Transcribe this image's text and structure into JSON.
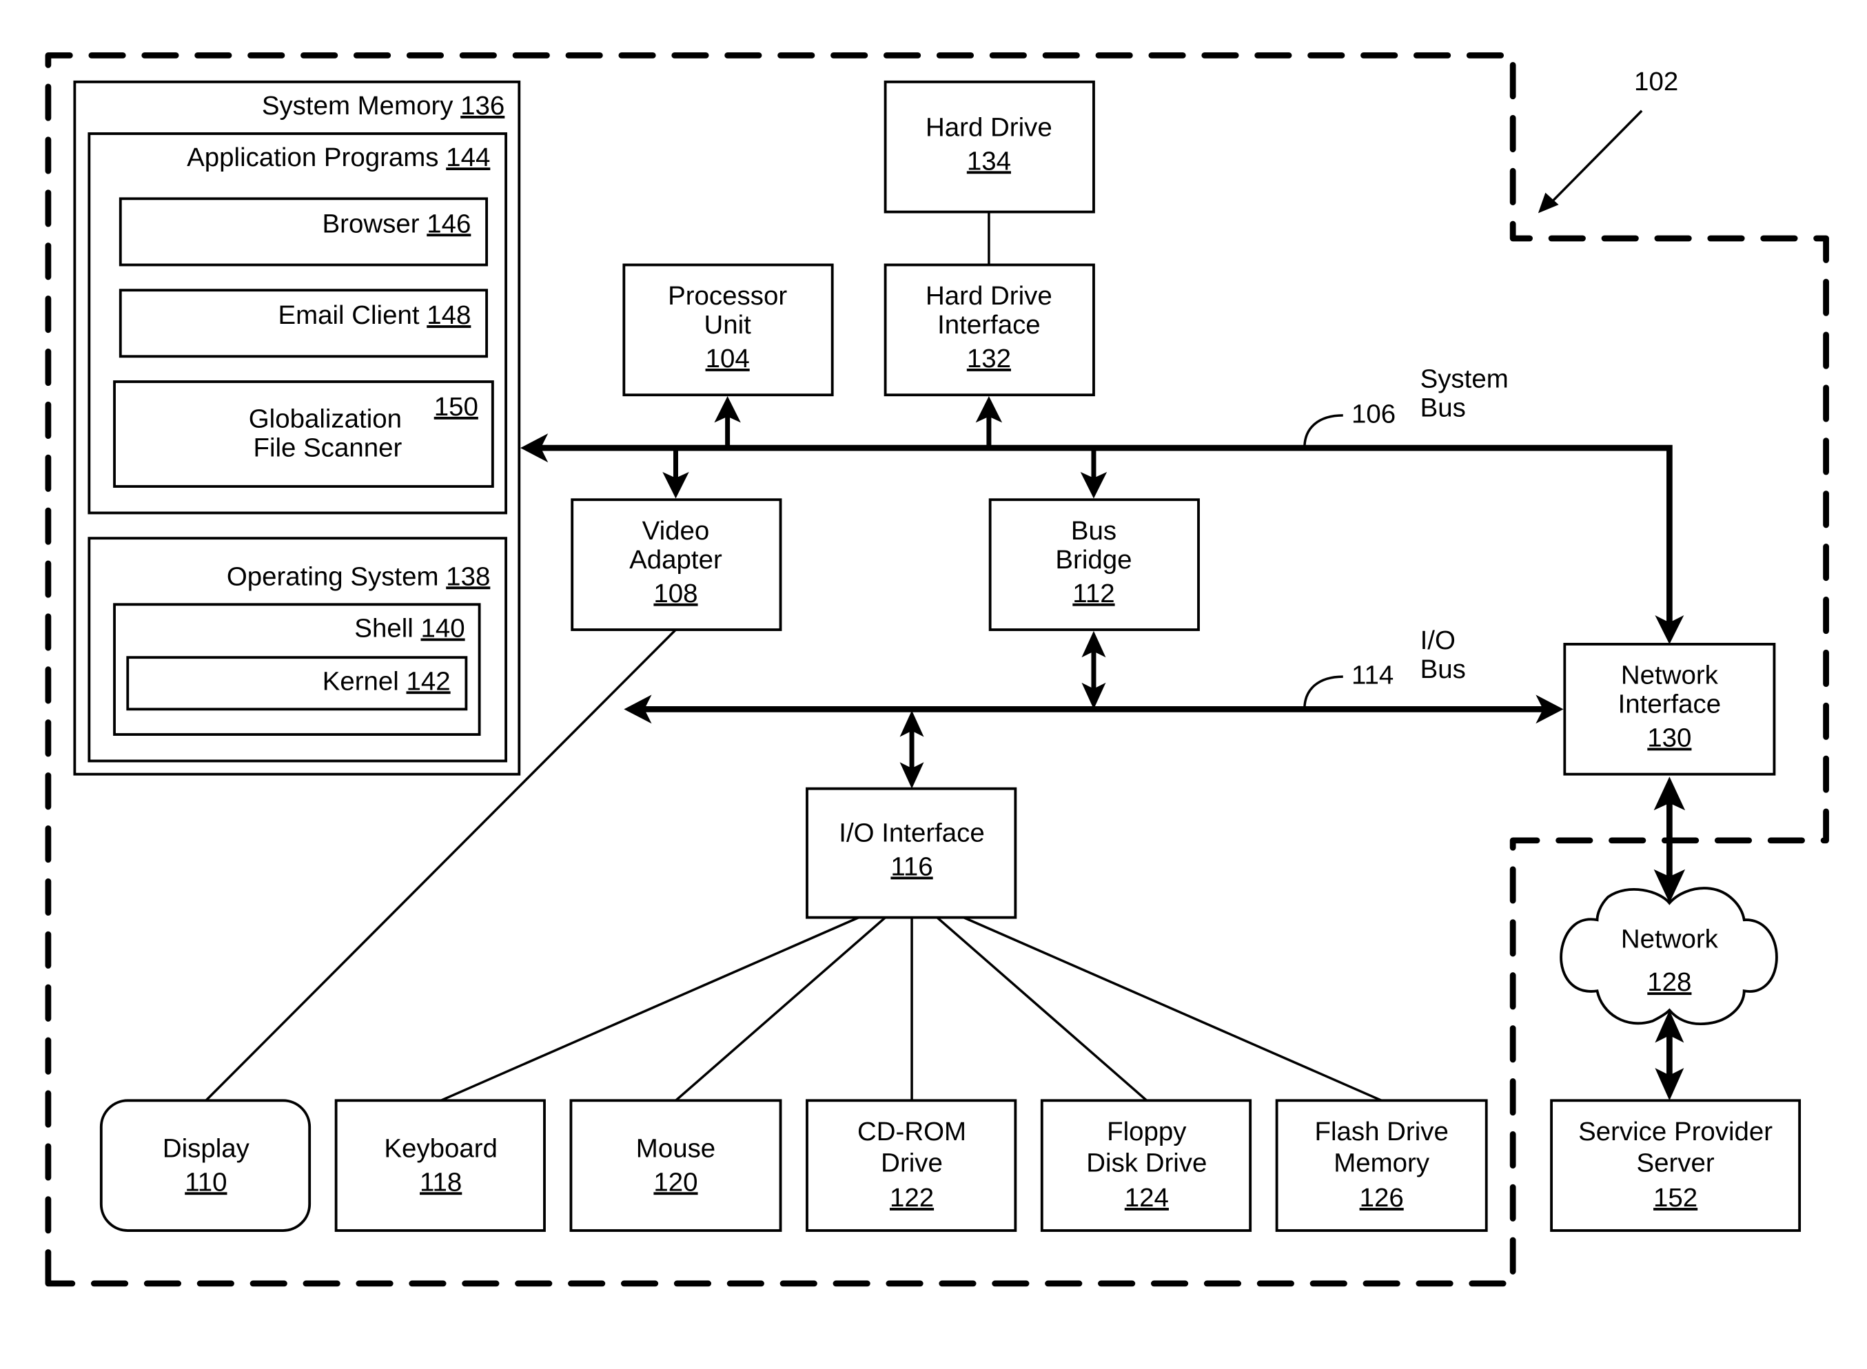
{
  "figure_ref": "102",
  "buses": {
    "system_bus": {
      "ref": "106",
      "label_line1": "System",
      "label_line2": "Bus"
    },
    "io_bus": {
      "ref": "114",
      "label_line1": "I/O",
      "label_line2": "Bus"
    }
  },
  "system_memory": {
    "label": "System Memory",
    "ref": "136",
    "application_programs": {
      "label": "Application Programs",
      "ref": "144",
      "browser": {
        "label": "Browser",
        "ref": "146"
      },
      "email_client": {
        "label": "Email Client",
        "ref": "148"
      },
      "globalization": {
        "line1": "Globalization",
        "line2": "File Scanner",
        "ref": "150"
      }
    },
    "operating_system": {
      "label": "Operating System",
      "ref": "138",
      "shell": {
        "label": "Shell",
        "ref": "140"
      },
      "kernel": {
        "label": "Kernel",
        "ref": "142"
      }
    }
  },
  "components": {
    "hard_drive": {
      "line1": "Hard Drive",
      "ref": "134"
    },
    "processor": {
      "line1": "Processor",
      "line2": "Unit",
      "ref": "104"
    },
    "hd_interface": {
      "line1": "Hard Drive",
      "line2": "Interface",
      "ref": "132"
    },
    "video_adapter": {
      "line1": "Video",
      "line2": "Adapter",
      "ref": "108"
    },
    "bus_bridge": {
      "line1": "Bus",
      "line2": "Bridge",
      "ref": "112"
    },
    "network_interface": {
      "line1": "Network",
      "line2": "Interface",
      "ref": "130"
    },
    "io_interface": {
      "line1": "I/O Interface",
      "ref": "116"
    },
    "network": {
      "line1": "Network",
      "ref": "128"
    },
    "display": {
      "line1": "Display",
      "ref": "110"
    },
    "keyboard": {
      "line1": "Keyboard",
      "ref": "118"
    },
    "mouse": {
      "line1": "Mouse",
      "ref": "120"
    },
    "cdrom": {
      "line1": "CD-ROM",
      "line2": "Drive",
      "ref": "122"
    },
    "floppy": {
      "line1": "Floppy",
      "line2": "Disk Drive",
      "ref": "124"
    },
    "flash": {
      "line1": "Flash Drive",
      "line2": "Memory",
      "ref": "126"
    },
    "service_provider": {
      "line1": "Service Provider",
      "line2": "Server",
      "ref": "152"
    }
  }
}
